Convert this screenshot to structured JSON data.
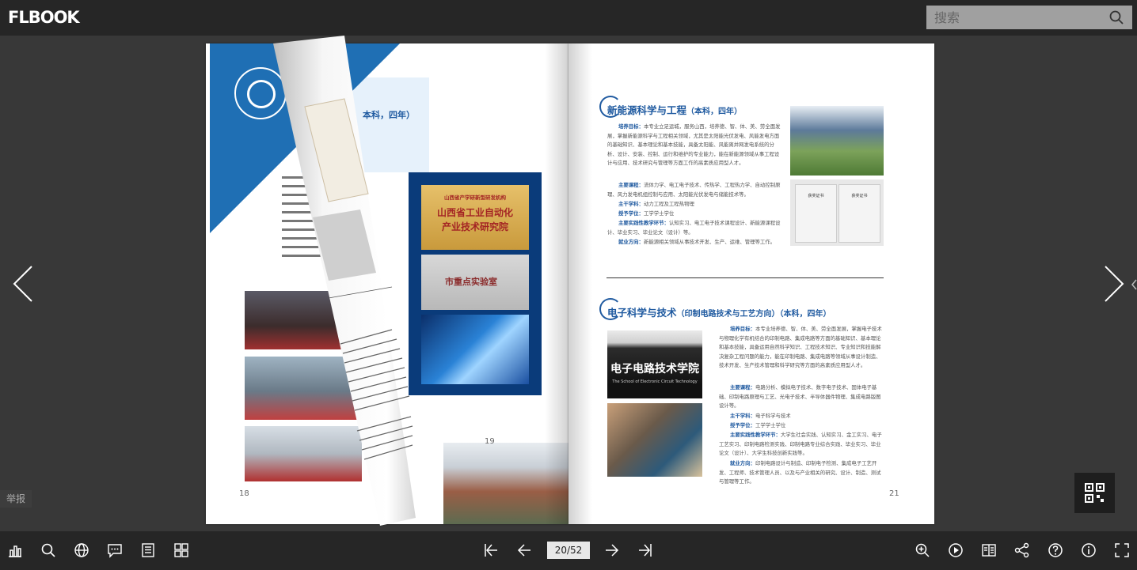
{
  "app": {
    "logo": "FLBOOK"
  },
  "search": {
    "placeholder": "搜索"
  },
  "report": {
    "label": "举报"
  },
  "pager": {
    "current": "20/52"
  },
  "left_page": {
    "heading": "本科，四年）",
    "page_number": "18",
    "plaque_gold_line1": "山西省产学研新型研发机构",
    "plaque_gold_line2": "山西省工业自动化",
    "plaque_gold_line3": "产业技术研究院",
    "plaque_silver": "市重点实验室",
    "curl_page_number": "19"
  },
  "right_page": {
    "page_number": "21",
    "section1": {
      "title": "新能源科学与工程",
      "title_suffix": "（本科，四年）",
      "goal_label": "培养目标：",
      "goal": "本专业立足运城，服务山西，培养德、智、体、美、劳全面发展，掌握新能源科学与工程相关领域，尤其是太阳能光伏发电、风能发电方面的基础知识、基本理论和基本技能，具备太阳能、风能离并网发电系统的分析、设计、安装、控制、运行和维护的专业能力，能在新能源领域从事工程设计与应用、技术研究与管理等方面工作的高素质应用型人才。",
      "courses_label": "主要课程：",
      "courses": "流体力学、电工电子技术、传热学、工程热力学、自动控制原理、风力发电机组控制与应用、太阳能光伏发电与储能技术等。",
      "discipline_label": "主干学科：",
      "discipline": "动力工程及工程热物理",
      "degree_label": "授予学位：",
      "degree": "工学学士学位",
      "practice_label": "主要实践性教学环节：",
      "practice": "认知实习、电工电子技术课程设计、新能源课程设计、毕业实习、毕业论文（设计）等。",
      "career_label": "就业方向：",
      "career": "新能源相关领域从事技术开发、生产、运维、管理等工作。",
      "cert1": "获奖证书",
      "cert2": "获奖证书"
    },
    "section2": {
      "title": "电子科学与技术",
      "title_suffix": "（印制电路技术与工艺方向）（本科，四年）",
      "goal_label": "培养目标：",
      "goal": "本专业培养德、智、体、美、劳全面发展，掌握电子技术与物理化学有机结合的印制电路、集成电路等方面的基础知识、基本理论和基本技能，具备运用自然科学知识、工程技术知识、专业知识和技能解决复杂工程问题的能力，能在印制电路、集成电路等领域从事设计制造、技术开发、生产技术管理和科学研究等方面的高素质应用型人才。",
      "courses_label": "主要课程：",
      "courses": "电路分析、模拟电子技术、数字电子技术、固体电子基础、印制电路原理与工艺、光电子技术、半导体器件物理、集成电路版图设计等。",
      "discipline_label": "主干学科：",
      "discipline": "电子科学与技术",
      "degree_label": "授予学位：",
      "degree": "工学学士学位",
      "practice_label": "主要实践性教学环节：",
      "practice": "大学生社会实践、认知实习、金工实习、电子工艺实习、印制电路检测实践、印制电路专业综合实践、毕业实习、毕业论文（设计）、大学生科技创新实践等。",
      "career_label": "就业方向：",
      "career": "印制电路设计与制造、印制电子检测、集成电子工艺开发、工程师、技术管理人员、以及与产业相关的研究、设计、制造、测试与管理等工作。",
      "sign_text": "电子电路技术学院",
      "sign_sub": "The School of Electronic Circuit Technology"
    }
  },
  "colors": {
    "topbar": "#262626",
    "stage": "#383838",
    "accent": "#1f5aa0"
  }
}
